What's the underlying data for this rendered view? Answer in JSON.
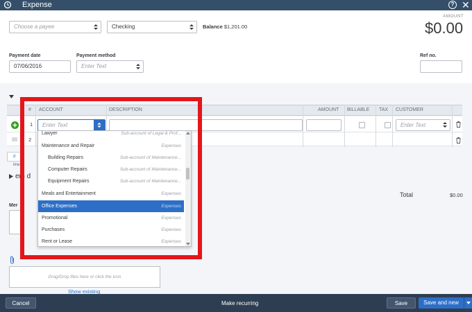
{
  "window": {
    "title": "Expense"
  },
  "header": {
    "payee_placeholder": "Choose a payee",
    "account": "Checking",
    "balance_label": "Balance",
    "balance_value": "$1,201.00",
    "amount_label": "AMOUNT",
    "amount_value": "$0.00",
    "payment_date_label": "Payment date",
    "payment_date": "07/06/2016",
    "payment_method_label": "Payment method",
    "payment_method_placeholder": "Enter Text",
    "ref_label": "Ref no."
  },
  "grid": {
    "columns": [
      "#",
      "ACCOUNT",
      "DESCRIPTION",
      "AMOUNT",
      "BILLABLE",
      "TAX",
      "CUSTOMER"
    ],
    "rows": [
      {
        "num": "1",
        "account_placeholder": "Enter Text",
        "customer_placeholder": "Enter Text"
      },
      {
        "num": "2"
      }
    ],
    "add_lines_fragment": "d lines",
    "item_details_fragment": "em d"
  },
  "dropdown": {
    "items": [
      {
        "name": "Lawyer",
        "type": "Sub-account of Legal & Prof...",
        "sub": false,
        "selected": false
      },
      {
        "name": "Maintenance and Repair",
        "type": "Expenses",
        "sub": false,
        "selected": false
      },
      {
        "name": "Building Repairs",
        "type": "Sub-account of Maintenance...",
        "sub": true,
        "selected": false
      },
      {
        "name": "Computer Repairs",
        "type": "Sub-account of Maintenance...",
        "sub": true,
        "selected": false
      },
      {
        "name": "Equipment Repairs",
        "type": "Sub-account of Maintenance...",
        "sub": true,
        "selected": false
      },
      {
        "name": "Meals and Entertainment",
        "type": "Expenses",
        "sub": false,
        "selected": false
      },
      {
        "name": "Office Expenses",
        "type": "Expenses",
        "sub": false,
        "selected": true
      },
      {
        "name": "Promotional",
        "type": "Expenses",
        "sub": false,
        "selected": false
      },
      {
        "name": "Purchases",
        "type": "Expenses",
        "sub": false,
        "selected": false
      },
      {
        "name": "Rent or Lease",
        "type": "Expenses",
        "sub": false,
        "selected": false
      }
    ]
  },
  "totals": {
    "label": "Total",
    "value": "$0.00"
  },
  "memo": {
    "label_fragment": "Mer"
  },
  "attachments": {
    "drop_text": "Drag/Drop files here or click the icon",
    "show_existing": "Show existing"
  },
  "footer": {
    "cancel": "Cancel",
    "make_recurring": "Make recurring",
    "save": "Save",
    "save_and_new": "Save and new"
  },
  "colors": {
    "topbar": "#354f6b",
    "footer": "#2e3e52",
    "selected": "#2d6fc7",
    "highlight_box": "#e4161b",
    "add_button": "#2ca01c"
  }
}
